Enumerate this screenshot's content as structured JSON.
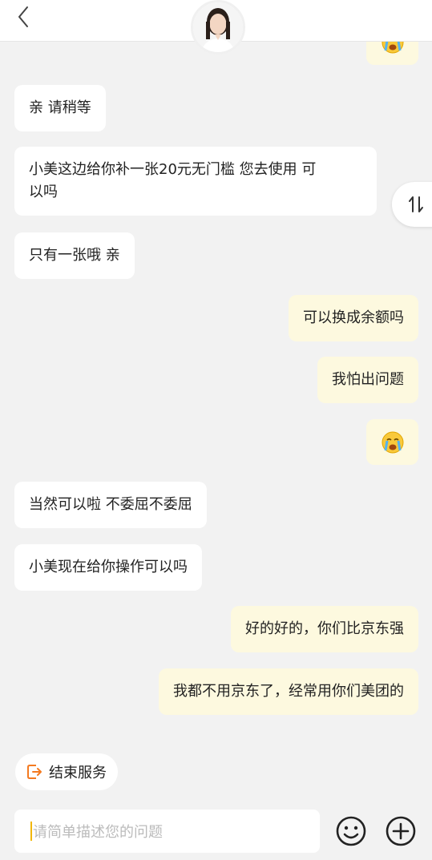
{
  "header": {
    "back_icon": "chevron-left-icon",
    "avatar_icon": "agent-avatar"
  },
  "messages": [
    {
      "side": "right",
      "type": "emoji",
      "emoji": "crying-face"
    },
    {
      "side": "left",
      "text": "亲 请稍等"
    },
    {
      "side": "left",
      "text_line1": "小美这边给你补一张20元无门槛 您去使用 可",
      "text_line2": "以吗"
    },
    {
      "side": "left",
      "text": "只有一张哦 亲"
    },
    {
      "side": "right",
      "text": "可以换成余额吗"
    },
    {
      "side": "right",
      "text": "我怕出问题"
    },
    {
      "side": "right",
      "type": "emoji",
      "emoji": "crying-face"
    },
    {
      "side": "left",
      "text": "当然可以啦 不委屈不委屈"
    },
    {
      "side": "left",
      "text": "小美现在给你操作可以吗"
    },
    {
      "side": "right",
      "text": "好的好的，你们比京东强"
    },
    {
      "side": "right",
      "text": "我都不用京东了，经常用你们美团的"
    }
  ],
  "scroll_toggle": {
    "label": "⇅",
    "icon": "swap-vertical-icon"
  },
  "footer": {
    "end_service_label": "结束服务",
    "input_placeholder": "请简单描述您的问题",
    "emoji_icon": "smiley-icon",
    "add_icon": "plus-circle-icon"
  },
  "colors": {
    "accent": "#f47a20",
    "bubble_self": "#fdf9df",
    "bubble_agent": "#ffffff",
    "background": "#f2f2f2"
  }
}
